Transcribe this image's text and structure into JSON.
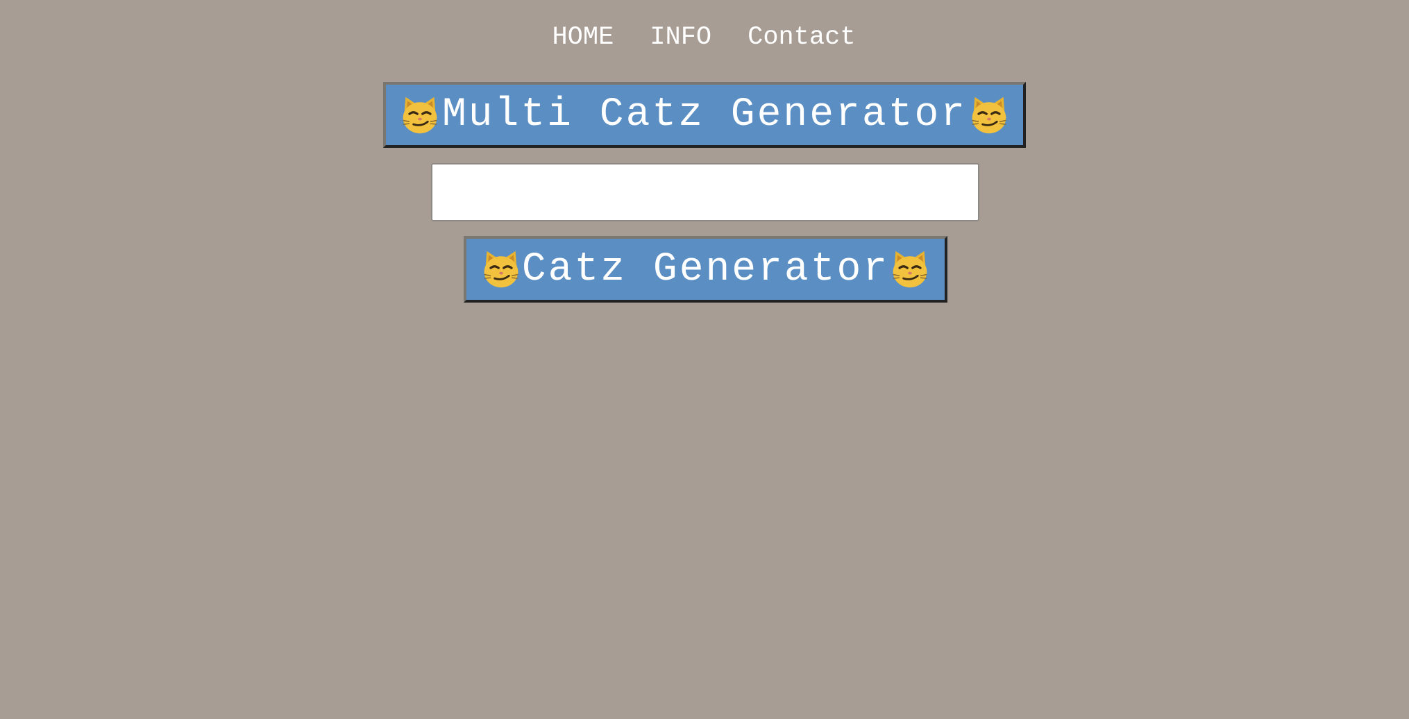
{
  "nav": {
    "items": [
      {
        "label": "HOME"
      },
      {
        "label": "INFO"
      },
      {
        "label": "Contact"
      }
    ]
  },
  "header": {
    "title": "Multi Catz Generator",
    "icon": "smirking-cat-icon"
  },
  "form": {
    "input_value": "",
    "input_placeholder": "",
    "button_label": "Catz Generator",
    "button_icon": "smirking-cat-icon"
  },
  "colors": {
    "background": "#a89d95",
    "accent": "#5b8fc4",
    "text": "#ffffff"
  }
}
